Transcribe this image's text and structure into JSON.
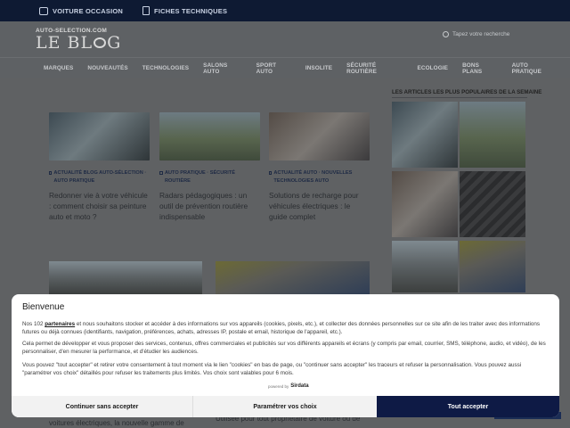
{
  "topbar": {
    "items": [
      "VOITURE OCCASION",
      "FICHES TECHNIQUES"
    ]
  },
  "logo": {
    "small": "AUTO-SELECTION.COM",
    "big_left": "LE BL",
    "big_right": "G"
  },
  "search": {
    "placeholder": "Tapez votre recherche"
  },
  "nav": [
    "MARQUES",
    "NOUVEAUTÉS",
    "TECHNOLOGIES",
    "SALONS AUTO",
    "SPORT AUTO",
    "INSOLITE",
    "SÉCURITÉ ROUTIÈRE",
    "ECOLOGIE",
    "BONS PLANS",
    "AUTO PRATIQUE"
  ],
  "articles": [
    {
      "category": "ACTUALITÉ BLOG AUTO-SÉLECTION · AUTO PRATIQUE",
      "title": "Redonner vie à votre véhicule : comment choisir sa peinture auto et moto ?"
    },
    {
      "category": "AUTO PRATIQUE · SÉCURITÉ ROUTIÈRE",
      "title": "Radars pédagogiques : un outil de prévention routière indispensable"
    },
    {
      "category": "ACTUALITÉ AUTO · NOUVELLES TECHNOLOGIES AUTO",
      "title": "Solutions de recharge pour véhicules électriques : le guide complet"
    }
  ],
  "sidebar": {
    "title": "LES ARTICLES LES PLUS POPULAIRES DE LA SEMAINE"
  },
  "bottom_text": {
    "left": "voitures électriques, la nouvelle gamme de",
    "right": "Utilisée pour tout propriétaire de voiture ou de"
  },
  "consent": {
    "heading": "Bienvenue",
    "p1_a": "Nos 102 ",
    "p1_link": "partenaires",
    "p1_b": " et nous souhaitons stocker et accéder à des informations sur vos appareils (cookies, pixels, etc.), et collecter des données personnelles sur ce site afin de les traiter avec des informations futures ou déjà connues (identifiants, navigation, préférences, achats, adresses IP, postale et email, historique de l'appareil, etc.).",
    "p2": "Cela permet de développer et vous proposer des services, contenus, offres commerciales et publicités sur vos différents appareils et écrans (y compris par email, courrier, SMS, téléphone, audio, et vidéo), de les personnaliser, d'en mesurer la performance, et d'étudier les audiences.",
    "p3": "Vous pouvez \"tout accepter\" et retirer votre consentement à tout moment via le lien \"cookies\" en bas de page, ou \"continuer sans accepter\" les traceurs et refuser la personnalisation. Vous pouvez aussi \"paramétrer vos choix\" détaillés pour refuser les traitements plus limités. Vos choix sont valables pour 6 mois.",
    "powered_by": "powered by",
    "brand": "Sirdata",
    "buttons": {
      "continue": "Continuer sans accepter",
      "settings": "Paramétrer vos choix",
      "accept": "Tout accepter"
    }
  }
}
